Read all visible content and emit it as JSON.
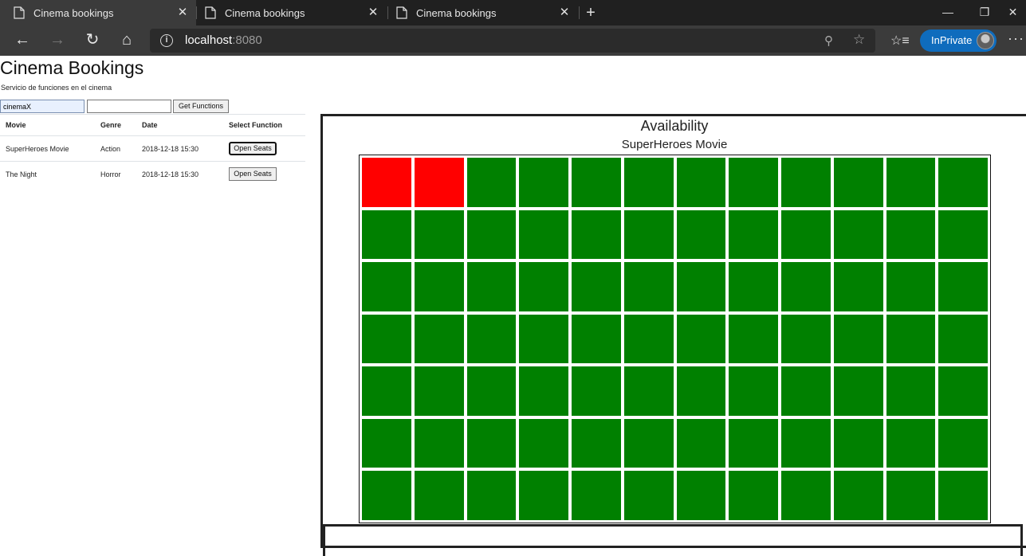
{
  "browser": {
    "tabs": [
      {
        "title": "Cinema bookings",
        "active": true
      },
      {
        "title": "Cinema bookings",
        "active": false
      },
      {
        "title": "Cinema bookings",
        "active": false
      }
    ],
    "url_host": "localhost",
    "url_port": ":8080",
    "inprivate_label": "InPrivate",
    "icons": [
      "document-icon",
      "close-icon",
      "new-tab-icon",
      "back-icon",
      "forward-icon",
      "refresh-icon",
      "home-icon",
      "info-icon",
      "zoom-icon",
      "star-icon",
      "favorites-icon",
      "more-icon"
    ]
  },
  "page": {
    "title": "Cinema Bookings",
    "subtitle": "Servicio de funciones en el cinema",
    "cinema_input_value": "cinemaX",
    "date_input_value": "",
    "get_functions_label": "Get Functions",
    "table": {
      "headers": [
        "Movie",
        "Genre",
        "Date",
        "Select Function"
      ],
      "rows": [
        {
          "movie": "SuperHeroes Movie",
          "genre": "Action",
          "date": "2018-12-18 15:30",
          "action": "Open Seats"
        },
        {
          "movie": "The Night",
          "genre": "Horror",
          "date": "2018-12-18 15:30",
          "action": "Open Seats"
        }
      ]
    },
    "availability": {
      "title": "Availability",
      "movie": "SuperHeroes Movie",
      "rows": 7,
      "cols": 12,
      "taken_seats": [
        [
          0,
          0
        ],
        [
          0,
          1
        ]
      ],
      "colors": {
        "available": "#008000",
        "taken": "#ff0000"
      }
    }
  }
}
